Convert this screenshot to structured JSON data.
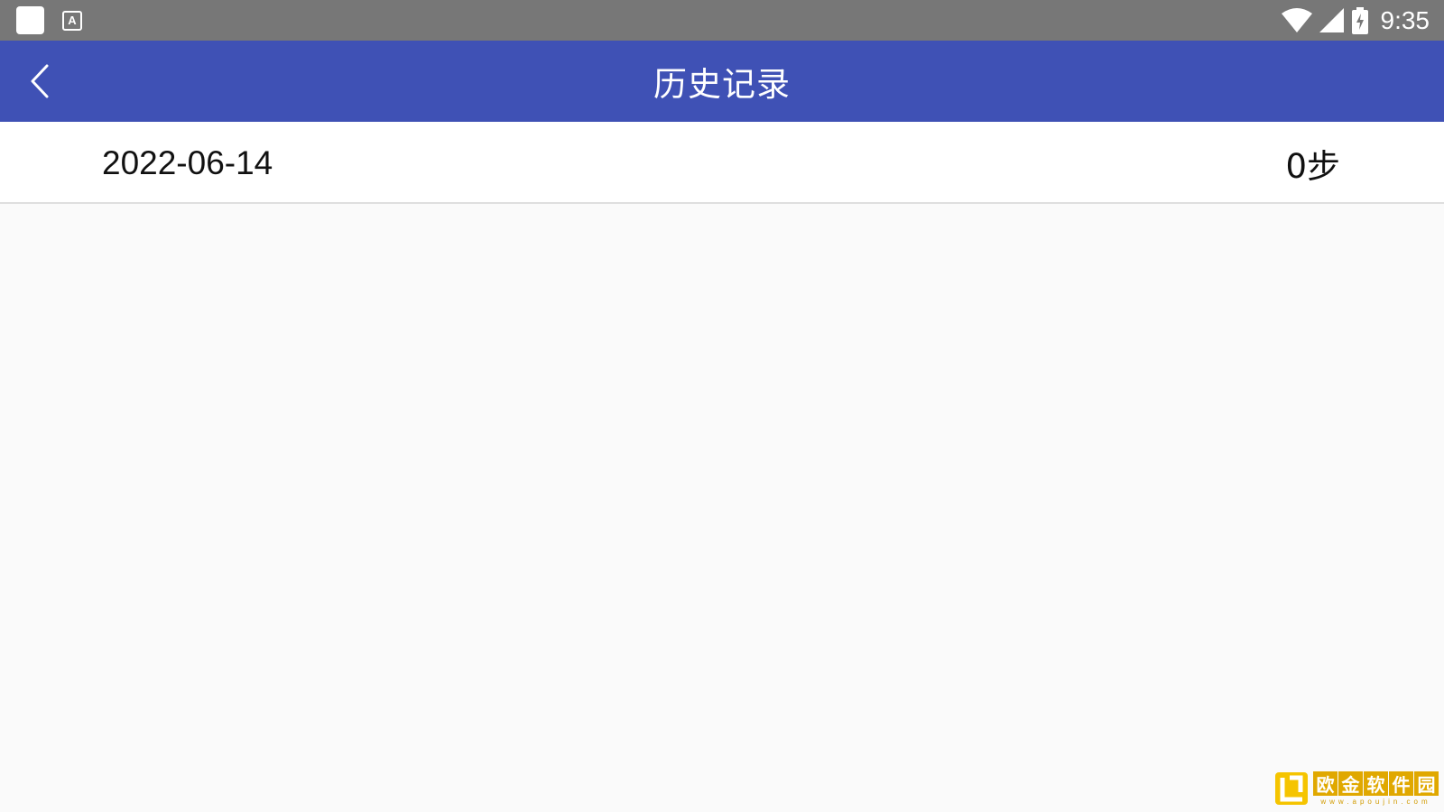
{
  "status_bar": {
    "time": "9:35",
    "notif_app_letter": "A"
  },
  "app_bar": {
    "title": "历史记录"
  },
  "history": [
    {
      "date": "2022-06-14",
      "steps": "0步"
    }
  ],
  "watermark": {
    "chars": [
      "欧",
      "金",
      "软",
      "件",
      "园"
    ],
    "url": "www.apoujin.com"
  },
  "colors": {
    "status_bar": "#777777",
    "app_bar": "#3f51b5",
    "background": "#fafafa",
    "watermark": "#e0a800"
  }
}
